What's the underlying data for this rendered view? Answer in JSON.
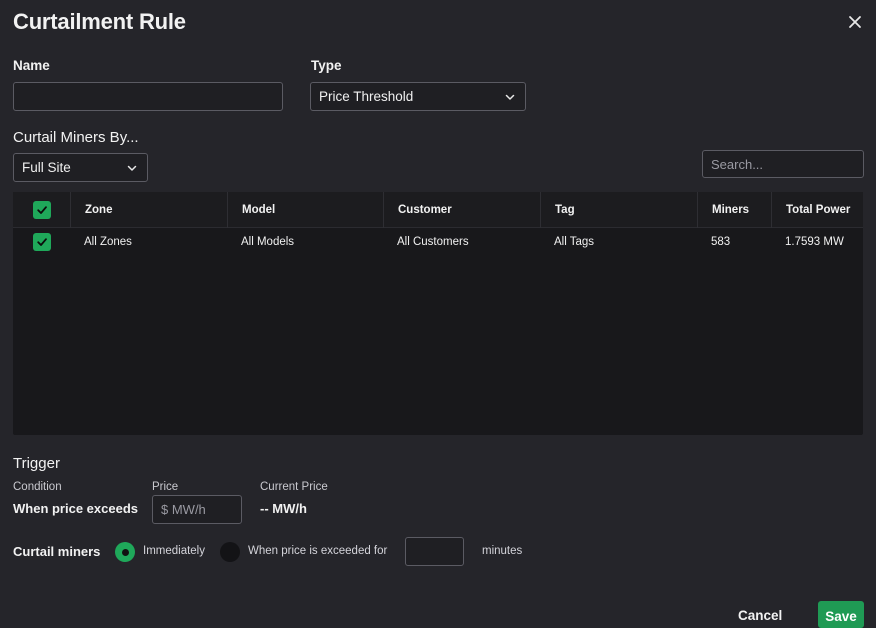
{
  "dialog": {
    "title": "Curtailment Rule"
  },
  "form": {
    "name_label": "Name",
    "name_value": "",
    "type_label": "Type",
    "type_value": "Price Threshold",
    "curtail_by_label": "Curtail Miners By...",
    "curtail_by_value": "Full Site",
    "search_placeholder": "Search..."
  },
  "table": {
    "columns": [
      "Zone",
      "Model",
      "Customer",
      "Tag",
      "Miners",
      "Total Power"
    ],
    "rows": [
      {
        "checked": true,
        "cells": [
          "All Zones",
          "All Models",
          "All Customers",
          "All Tags",
          "583",
          "1.7593 MW"
        ]
      }
    ]
  },
  "trigger": {
    "heading": "Trigger",
    "condition_label": "Condition",
    "condition_value": "When price exceeds",
    "price_label": "Price",
    "price_placeholder": "$ MW/h",
    "current_price_label": "Current Price",
    "current_price_value": "-- MW/h",
    "curtail_label": "Curtail miners",
    "option_immediately": "Immediately",
    "option_exceeded": "When price is exceeded for",
    "selected_option": "Immediately",
    "minutes_value": "",
    "minutes_label": "minutes"
  },
  "footer": {
    "cancel_label": "Cancel",
    "save_label": "Save"
  },
  "colors": {
    "background": "#25252a",
    "accent_green": "#1fa85a",
    "table_bg": "#18181b"
  },
  "icons": {
    "close": "close-icon",
    "dropdown": "chevron-down-icon",
    "checkbox": "check-icon"
  }
}
